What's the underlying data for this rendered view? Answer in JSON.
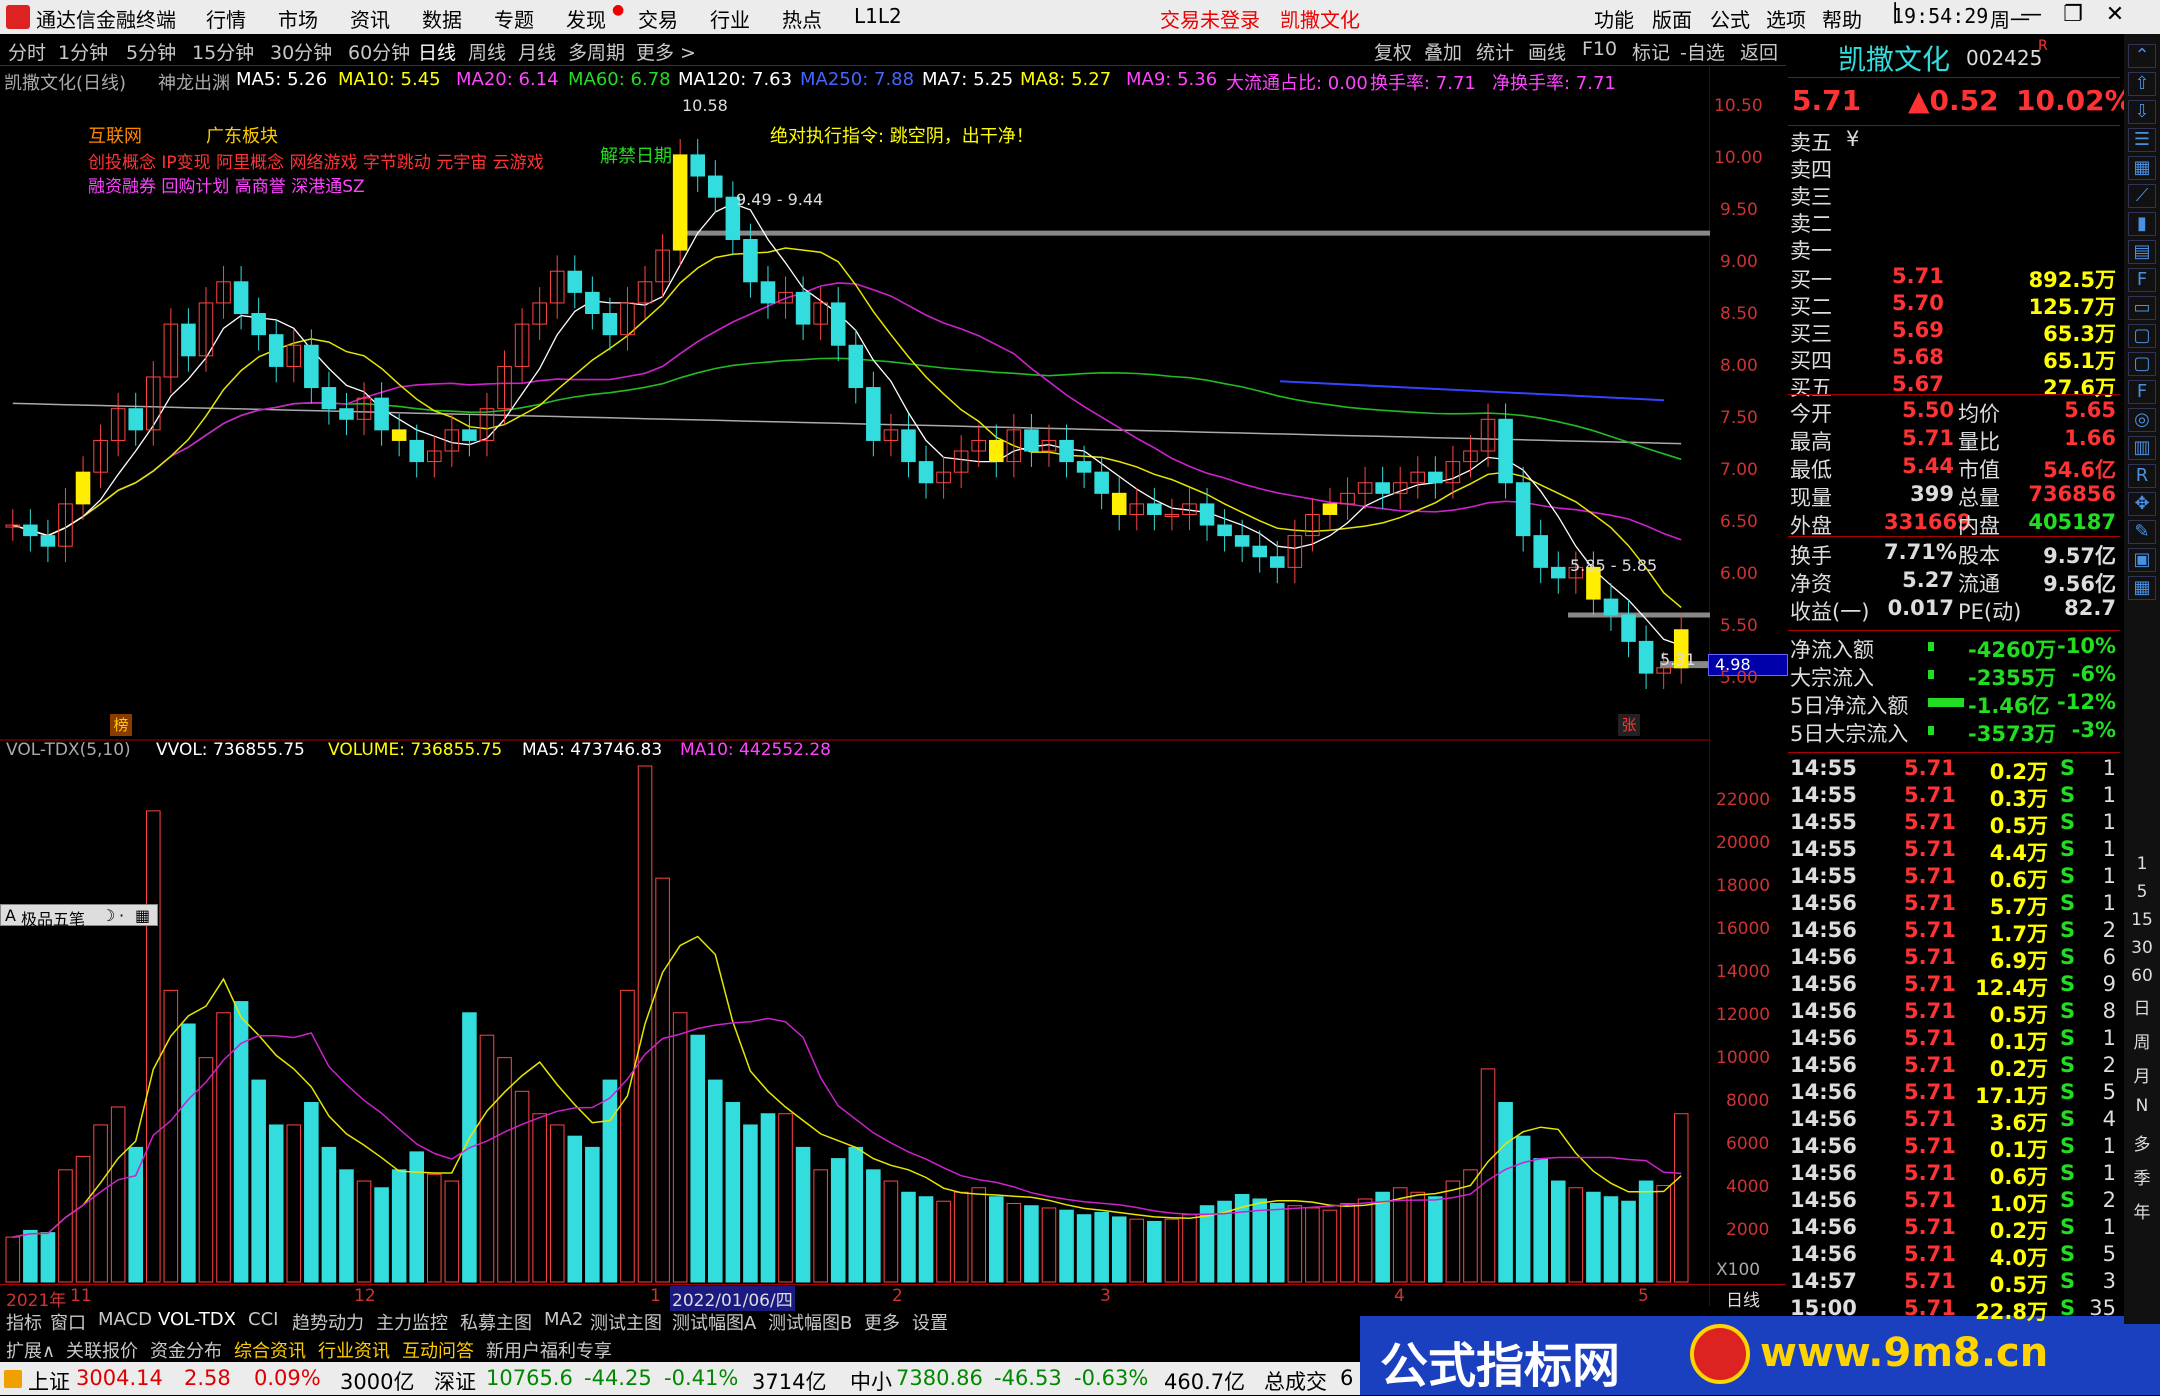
{
  "titlebar": {
    "app": "通达信金融终端",
    "menus": [
      "行情",
      "市场",
      "资讯",
      "数据",
      "专题",
      "发现",
      "交易",
      "行业",
      "热点",
      "L1L2"
    ],
    "login": "交易未登录",
    "stock": "凯撒文化",
    "menus_right": [
      "功能",
      "版面",
      "公式",
      "选项",
      "帮助"
    ],
    "time": "19:54:29",
    "weekday": "周一"
  },
  "periodbar": {
    "items": [
      "分时",
      "1分钟",
      "5分钟",
      "15分钟",
      "30分钟",
      "60分钟",
      "日线",
      "周线",
      "月线",
      "多周期",
      "更多 >"
    ],
    "active": "日线",
    "right": [
      "复权",
      "叠加",
      "统计",
      "画线",
      "F10",
      "标记",
      "-自选",
      "返回"
    ]
  },
  "maline": {
    "name": "凯撒文化(日线)",
    "indicator": "神龙出渊",
    "ma5": "MA5: 5.26",
    "ma10": "MA10: 5.45",
    "ma20": "MA20: 6.14",
    "ma60": "MA60: 6.78",
    "ma120": "MA120: 7.63",
    "ma250": "MA250: 7.88",
    "ma7": "MA7: 5.25",
    "ma8": "MA8: 5.27",
    "ma9": "MA9: 5.36",
    "dlt": "大流通占比: 0.00",
    "hsl": "换手率: 7.71",
    "jhsl": "净换手率: 7.71"
  },
  "annotations": {
    "concept1": "互联网",
    "concept2": "广东板块",
    "concept3": "创投概念 IP变现 阿里概念 网络游戏 字节跳动 元宇宙 云游戏",
    "concept4": "融资融券 回购计划 高商誉 深港通SZ",
    "unlock": "解禁日期",
    "command": "绝对执行指令:   跳空阴，出干净！",
    "high": "10.58",
    "line1": "9.49 - 9.44",
    "line2": "5.85 - 5.85",
    "low": "5.31",
    "cur": "4.98",
    "bang": "榜",
    "zhang": "张"
  },
  "price_axis": [
    "10.50",
    "10.00",
    "9.50",
    "9.00",
    "8.50",
    "8.00",
    "7.50",
    "7.00",
    "6.50",
    "6.00",
    "5.50",
    "5.00"
  ],
  "vol_axis": [
    "22000",
    "20000",
    "18000",
    "16000",
    "14000",
    "12000",
    "10000",
    "8000",
    "6000",
    "4000",
    "2000"
  ],
  "vol_unit": "X100",
  "volhead": {
    "name": "VOL-TDX(5,10)",
    "vvol": "VVOL: 736855.75",
    "volume": "VOLUME: 736855.75",
    "ma5": "MA5: 473746.83",
    "ma10": "MA10: 442552.28"
  },
  "toolbox": "极品五笔",
  "dates": [
    "2021年",
    "11",
    "12",
    "1",
    "2022/01/06/四",
    "2",
    "3",
    "4",
    "5",
    "日线"
  ],
  "tabs1": [
    "指标",
    "窗口",
    "MACD",
    "VOL-TDX",
    "CCI",
    "趋势动力",
    "主力监控",
    "私募主图",
    "MA2",
    "测试主图",
    "测试幅图A",
    "测试幅图B",
    "更多",
    "设置"
  ],
  "tabs2": [
    "扩展∧",
    "关联报价",
    "资金分布",
    "综合资讯",
    "行业资讯",
    "互动问答",
    "新用户福利专享"
  ],
  "statusbar": {
    "sh": "上证",
    "sh_v": "3004.14",
    "sh_c": "2.58",
    "sh_p": "0.09%",
    "sh_a": "3000亿",
    "sz": "深证",
    "sz_v": "10765.6",
    "sz_c": "-44.25",
    "sz_p": "-0.41%",
    "sz_a": "3714亿",
    "zx": "中小",
    "zx_v": "7380.86",
    "zx_c": "-46.53",
    "zx_p": "-0.63%",
    "zx_a": "460.7亿",
    "zcj": "总成交",
    "zcj_v": "6"
  },
  "banner": {
    "t1": "公式指标网",
    "t2": "www.9m8.cn"
  },
  "quote": {
    "name": "凯撒文化",
    "code": "002425",
    "r": "R",
    "price": "5.71",
    "change": "▲0.52",
    "pct": "10.02%",
    "asks": [
      [
        "卖五",
        "¥",
        ""
      ],
      [
        "卖四",
        "",
        ""
      ],
      [
        "卖三",
        "",
        ""
      ],
      [
        "卖二",
        "",
        ""
      ],
      [
        "卖一",
        "",
        ""
      ]
    ],
    "bids": [
      [
        "买一",
        "5.71",
        "892.5万"
      ],
      [
        "买二",
        "5.70",
        "125.7万"
      ],
      [
        "买三",
        "5.69",
        "65.3万"
      ],
      [
        "买四",
        "5.68",
        "65.1万"
      ],
      [
        "买五",
        "5.67",
        "27.6万"
      ]
    ],
    "stats": [
      [
        "今开",
        "5.50",
        "均价",
        "5.65"
      ],
      [
        "最高",
        "5.71",
        "量比",
        "1.66"
      ],
      [
        "最低",
        "5.44",
        "市值",
        "54.6亿"
      ],
      [
        "现量",
        "399",
        "总量",
        "736856"
      ],
      [
        "外盘",
        "331669",
        "内盘",
        "405187"
      ]
    ],
    "stats2": [
      [
        "换手",
        "7.71%",
        "股本",
        "9.57亿"
      ],
      [
        "净资",
        "5.27",
        "流通",
        "9.56亿"
      ],
      [
        "收益(一)",
        "0.017",
        "PE(动)",
        "82.7"
      ]
    ],
    "flows": [
      [
        "净流入额",
        "-4260万",
        "-10%"
      ],
      [
        "大宗流入",
        "-2355万",
        "-6%"
      ],
      [
        "5日净流入额",
        "-1.46亿",
        "-12%"
      ],
      [
        "5日大宗流入",
        "-3573万",
        "-3%"
      ]
    ],
    "ticks": [
      [
        "14:55",
        "5.71",
        "0.2万",
        "S",
        "1"
      ],
      [
        "14:55",
        "5.71",
        "0.3万",
        "S",
        "1"
      ],
      [
        "14:55",
        "5.71",
        "0.5万",
        "S",
        "1"
      ],
      [
        "14:55",
        "5.71",
        "4.4万",
        "S",
        "1"
      ],
      [
        "14:55",
        "5.71",
        "0.6万",
        "S",
        "1"
      ],
      [
        "14:56",
        "5.71",
        "5.7万",
        "S",
        "1"
      ],
      [
        "14:56",
        "5.71",
        "1.7万",
        "S",
        "2"
      ],
      [
        "14:56",
        "5.71",
        "6.9万",
        "S",
        "6"
      ],
      [
        "14:56",
        "5.71",
        "12.4万",
        "S",
        "9"
      ],
      [
        "14:56",
        "5.71",
        "0.5万",
        "S",
        "8"
      ],
      [
        "14:56",
        "5.71",
        "0.1万",
        "S",
        "1"
      ],
      [
        "14:56",
        "5.71",
        "0.2万",
        "S",
        "2"
      ],
      [
        "14:56",
        "5.71",
        "17.1万",
        "S",
        "5"
      ],
      [
        "14:56",
        "5.71",
        "3.6万",
        "S",
        "4"
      ],
      [
        "14:56",
        "5.71",
        "0.1万",
        "S",
        "1"
      ],
      [
        "14:56",
        "5.71",
        "0.6万",
        "S",
        "1"
      ],
      [
        "14:56",
        "5.71",
        "1.0万",
        "S",
        "2"
      ],
      [
        "14:56",
        "5.71",
        "0.2万",
        "S",
        "1"
      ],
      [
        "14:56",
        "5.71",
        "4.0万",
        "S",
        "5"
      ],
      [
        "14:57",
        "5.71",
        "0.5万",
        "S",
        "3"
      ],
      [
        "15:00",
        "5.71",
        "22.8万",
        "S",
        "35"
      ]
    ]
  },
  "side_toolbar": [
    "日",
    "周",
    "月",
    "N",
    "多",
    "季",
    "年"
  ],
  "side_toolbar_nums": [
    "1",
    "5",
    "15",
    "30",
    "60"
  ],
  "chart_data": {
    "type": "candlestick",
    "price_range": [
      4.8,
      10.7
    ],
    "volume_range_x100": [
      0,
      23000
    ],
    "close": [
      6.7,
      6.6,
      6.5,
      6.9,
      7.2,
      7.5,
      7.8,
      7.6,
      8.1,
      8.6,
      8.3,
      8.8,
      9.0,
      8.7,
      8.5,
      8.2,
      8.4,
      8.0,
      7.8,
      7.7,
      7.9,
      7.6,
      7.5,
      7.3,
      7.4,
      7.6,
      7.5,
      7.8,
      8.2,
      8.6,
      8.8,
      9.1,
      8.9,
      8.7,
      8.5,
      8.8,
      9.0,
      9.3,
      10.2,
      10.0,
      9.8,
      9.4,
      9.0,
      8.8,
      8.9,
      8.6,
      8.8,
      8.4,
      8.0,
      7.5,
      7.6,
      7.3,
      7.1,
      7.2,
      7.4,
      7.5,
      7.3,
      7.6,
      7.4,
      7.5,
      7.3,
      7.2,
      7.0,
      6.8,
      6.9,
      6.8,
      6.8,
      6.9,
      6.7,
      6.6,
      6.5,
      6.4,
      6.3,
      6.6,
      6.8,
      6.9,
      7.0,
      7.1,
      7.0,
      7.1,
      7.2,
      7.1,
      7.3,
      7.4,
      7.7,
      7.1,
      6.6,
      6.3,
      6.2,
      6.3,
      6.0,
      5.85,
      5.6,
      5.3,
      5.35,
      5.71
    ],
    "volume_x100": [
      2000,
      2300,
      2200,
      5000,
      5600,
      7000,
      7800,
      6000,
      21000,
      13000,
      11500,
      10000,
      12000,
      12500,
      9000,
      7000,
      7000,
      8000,
      6000,
      5000,
      4500,
      4200,
      5000,
      5800,
      4800,
      4500,
      12000,
      11000,
      10000,
      8500,
      7500,
      7000,
      6500,
      6000,
      9000,
      13000,
      23000,
      18000,
      12000,
      11000,
      9000,
      8000,
      7000,
      7500,
      7500,
      6000,
      5000,
      5500,
      6000,
      5000,
      4500,
      4000,
      3800,
      3600,
      4000,
      4200,
      3800,
      3500,
      3400,
      3300,
      3200,
      3000,
      3100,
      2900,
      2800,
      2700,
      2800,
      3000,
      3400,
      3600,
      3900,
      3700,
      3500,
      3400,
      3300,
      3200,
      3500,
      3700,
      4000,
      4200,
      4000,
      3800,
      4500,
      5000,
      9500,
      8000,
      6500,
      5500,
      4500,
      4200,
      4000,
      3800,
      3600,
      4500,
      4300,
      7500
    ]
  }
}
